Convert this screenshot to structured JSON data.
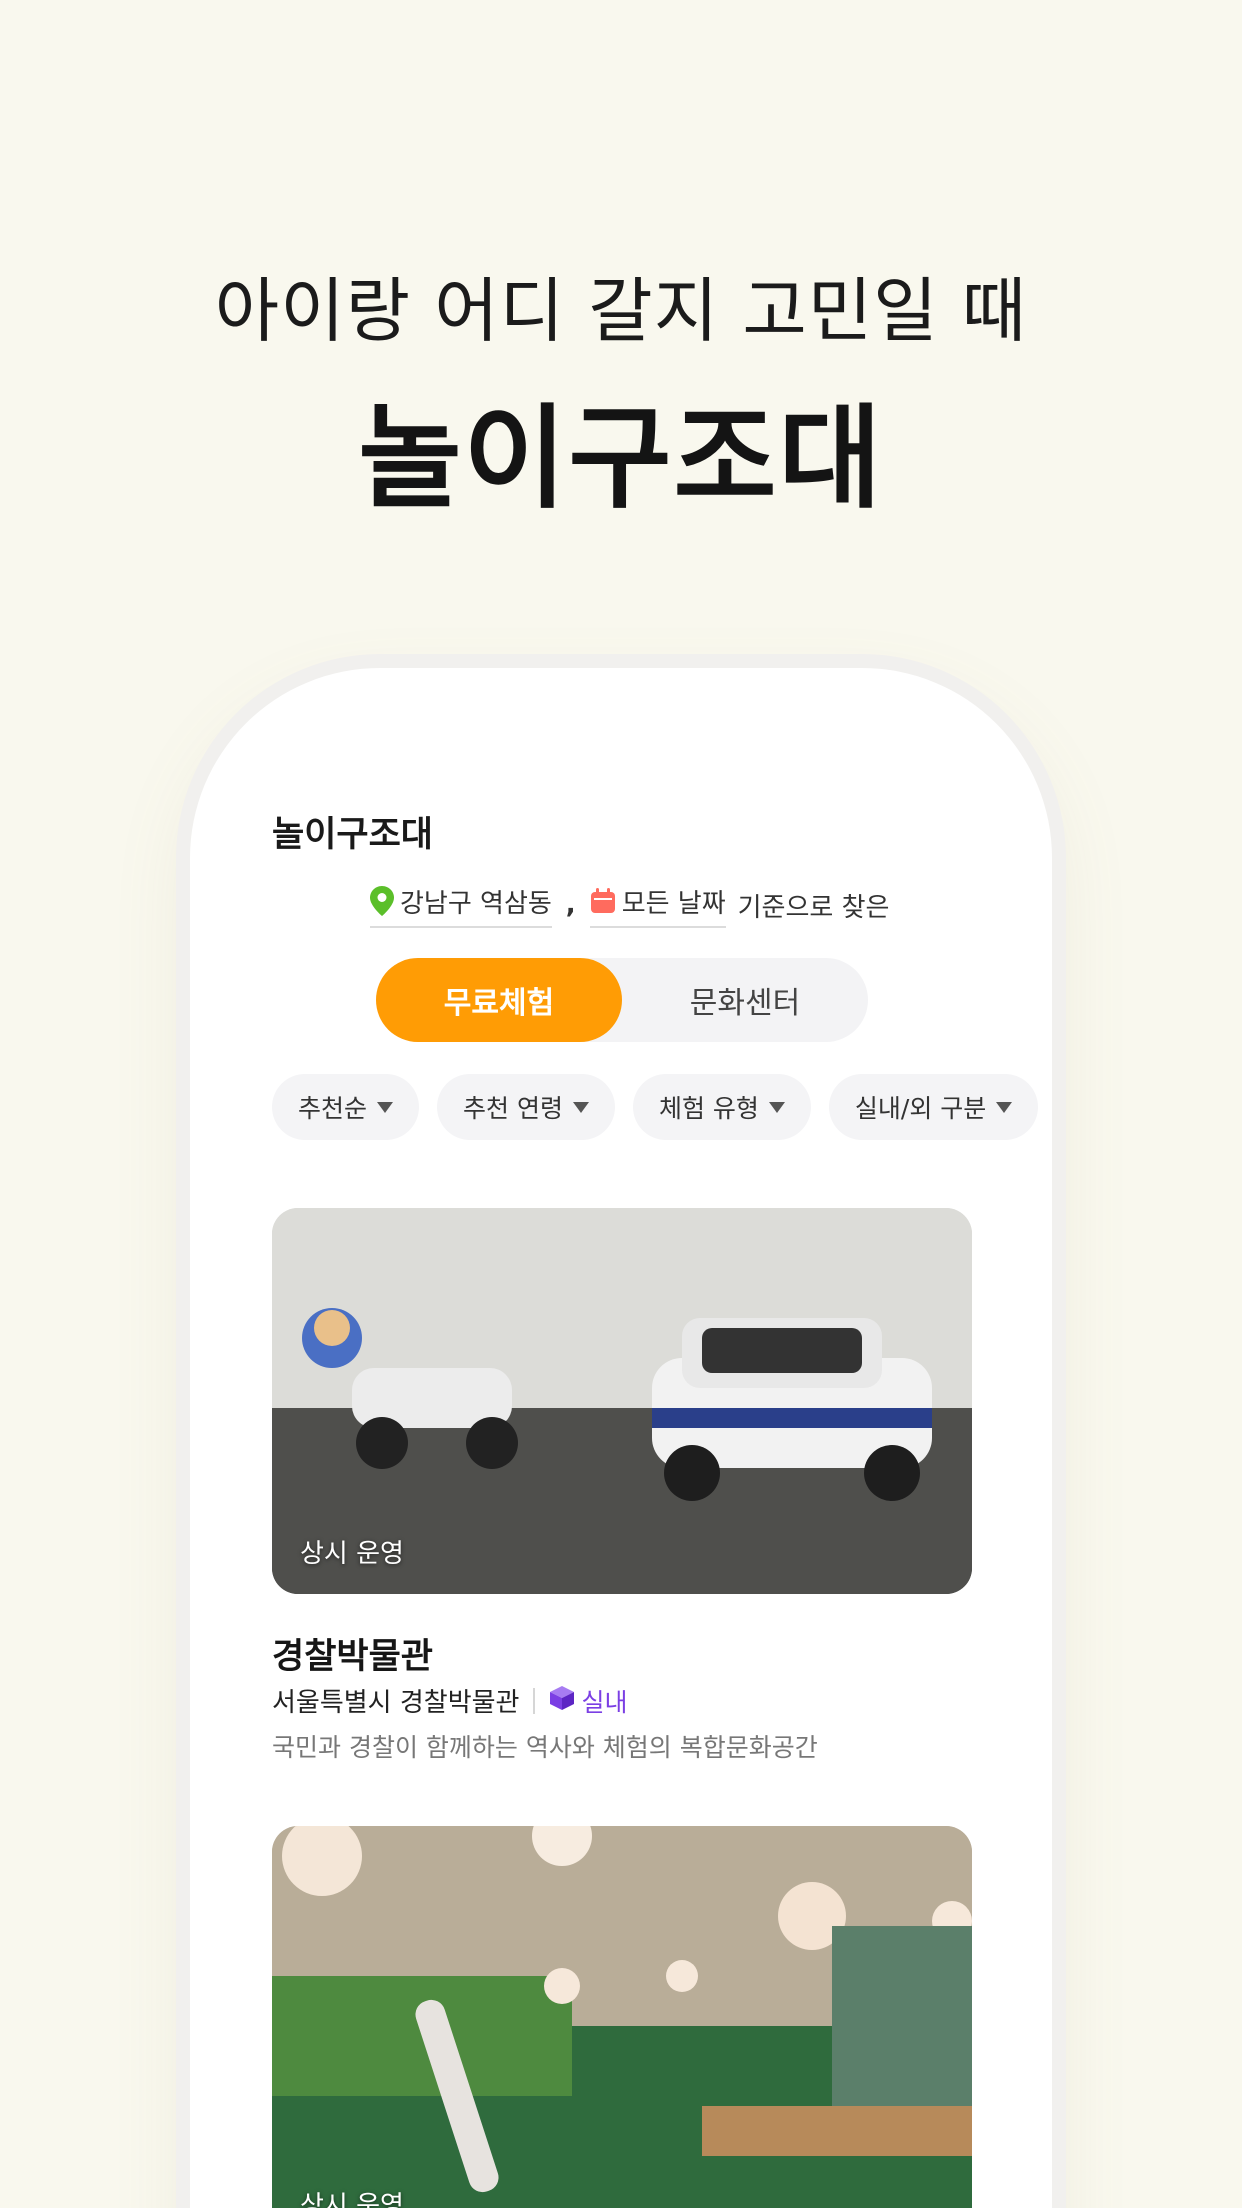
{
  "promo": {
    "subtitle": "아이랑 어디 갈지 고민일 때",
    "title": "놀이구조대"
  },
  "app": {
    "title": "놀이구조대",
    "filter": {
      "location": "강남구 역삼동",
      "separator": ",",
      "date": "모든 날짜",
      "suffix": "기준으로 찾은"
    },
    "tabs": [
      {
        "label": "무료체험",
        "active": true
      },
      {
        "label": "문화센터",
        "active": false
      }
    ],
    "sorts": [
      {
        "label": "추천순"
      },
      {
        "label": "추천 연령"
      },
      {
        "label": "체험 유형"
      },
      {
        "label": "실내/외 구분"
      }
    ],
    "cards": [
      {
        "image_label": "상시 운영",
        "name": "경찰박물관",
        "address": "서울특별시 경찰박물관",
        "type": "실내",
        "description": "국민과 경찰이 함께하는 역사와 체험의 복합문화공간"
      },
      {
        "image_label": "상시 운영"
      }
    ]
  },
  "colors": {
    "background": "#f9f8ee",
    "accent_orange": "#ff9c05",
    "indoor_purple": "#7b3fe4",
    "location_green": "#5bbf2a",
    "calendar_red": "#ff6b5e"
  }
}
